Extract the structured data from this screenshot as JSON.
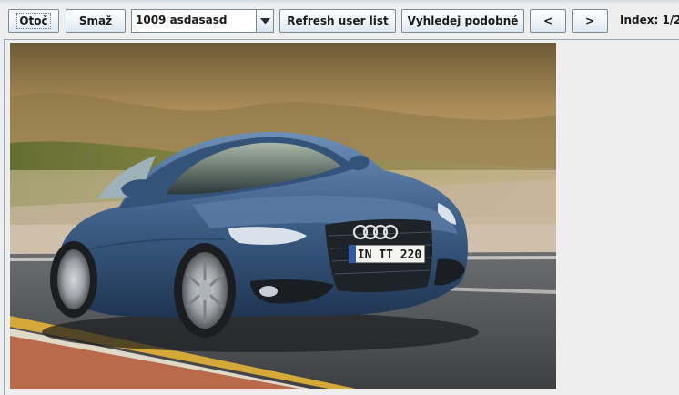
{
  "toolbar": {
    "rotate_label": "Otoč",
    "delete_label": "Smaž",
    "user_select": {
      "value": "1009 asdasasd"
    },
    "refresh_label": "Refresh user list",
    "find_similar_label": "Vyhledej podobné",
    "prev_label": "<",
    "next_label": ">",
    "index_text": "Index: 1/2"
  },
  "photo": {
    "license_plate": "IN TT 220"
  },
  "icons": {
    "dropdown": "chevron-down-icon"
  },
  "colors": {
    "window_bg": "#eeeeee",
    "button_border": "#7a8a99",
    "car_body": "#3f618a"
  }
}
